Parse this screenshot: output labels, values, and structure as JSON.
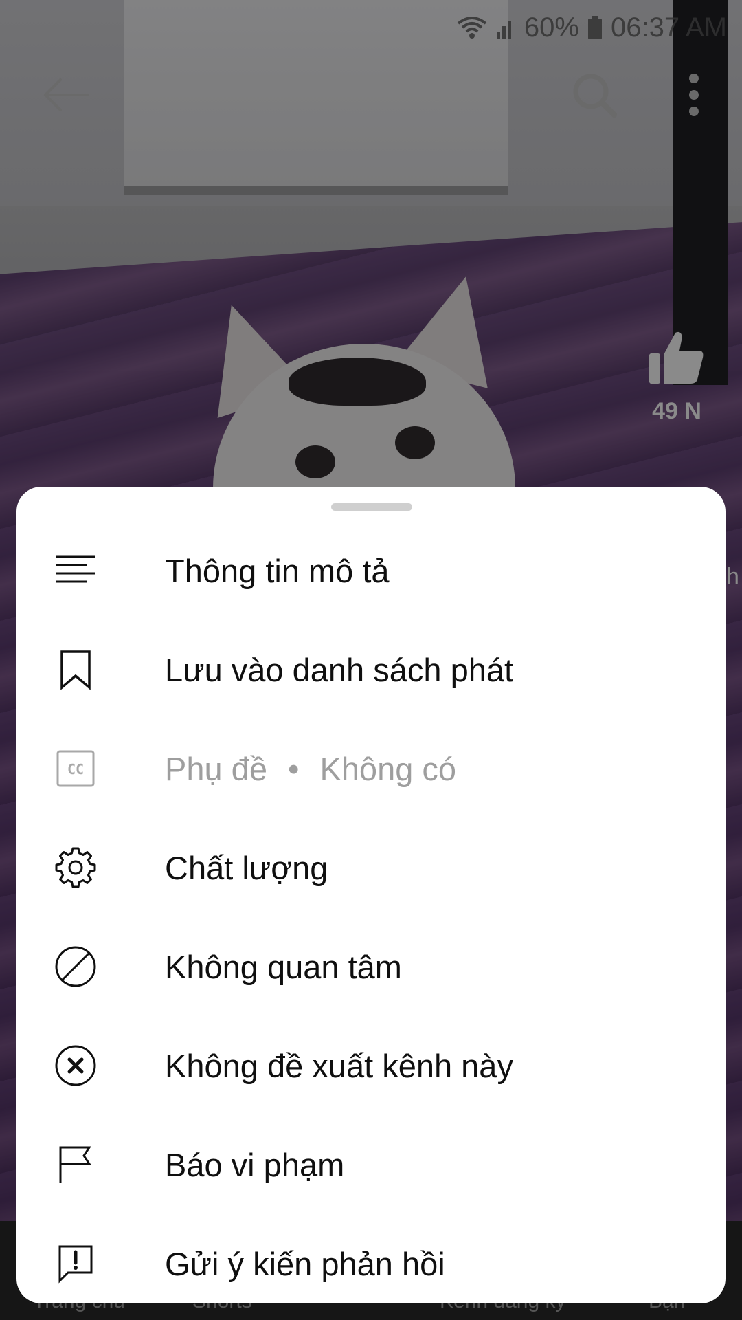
{
  "status_bar": {
    "battery": "60%",
    "time": "06:37 AM"
  },
  "top_bar": {
    "back_icon": "arrow-left-icon",
    "search_icon": "search-icon",
    "more_icon": "more-vert-icon"
  },
  "side_actions": {
    "like_count": "49 N",
    "partial_text": "ch"
  },
  "bottom_nav": {
    "items": [
      "Trang chủ",
      "Shorts",
      "",
      "Kênh đăng ký",
      "Bạn"
    ]
  },
  "menu": {
    "items": [
      {
        "label": "Thông tin mô tả",
        "icon": "description-icon"
      },
      {
        "label": "Lưu vào danh sách phát",
        "icon": "bookmark-icon"
      },
      {
        "label": "Phụ đề",
        "value": "Không có",
        "icon": "closed-captions-icon",
        "disabled": true
      },
      {
        "label": "Chất lượng",
        "icon": "gear-icon"
      },
      {
        "label": "Không quan tâm",
        "icon": "block-icon"
      },
      {
        "label": "Không đề xuất kênh này",
        "icon": "circle-x-icon"
      },
      {
        "label": "Báo vi phạm",
        "icon": "flag-icon"
      },
      {
        "label": "Gửi ý kiến phản hồi",
        "icon": "feedback-icon"
      }
    ]
  }
}
